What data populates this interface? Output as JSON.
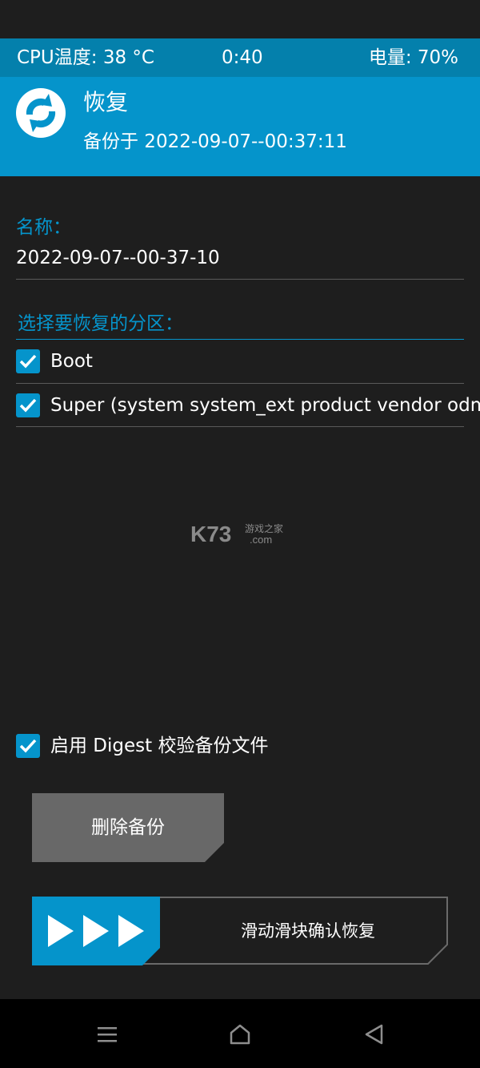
{
  "status_bar": {
    "cpu_temp": "CPU温度: 38 °C",
    "time": "0:40",
    "battery": "电量: 70%"
  },
  "header": {
    "title": "恢复",
    "subtitle": "备份于 2022-09-07--00:37:11",
    "logo_icon": "twrp-logo-icon"
  },
  "name_section": {
    "label": "名称：",
    "value": "2022-09-07--00-37-10"
  },
  "partition_section": {
    "label": "选择要恢复的分区：",
    "items": [
      {
        "label": "Boot",
        "checked": true
      },
      {
        "label": "Super (system system_ext product vendor odm",
        "checked": true
      }
    ]
  },
  "watermark": {
    "brand": "K73",
    "cn_text": "游戏之家",
    "domain": ".com"
  },
  "digest_option": {
    "label": "启用 Digest 校验备份文件",
    "checked": true
  },
  "delete_button": {
    "label": "删除备份"
  },
  "swipe_slider": {
    "label": "滑动滑块确认恢复"
  },
  "nav_bar": {
    "items": [
      "menu-icon",
      "home-icon",
      "back-icon"
    ]
  },
  "colors": {
    "accent": "#0594cb",
    "status_bar": "#0480ac",
    "background": "#1e1e1e",
    "button_gray": "#686868"
  }
}
